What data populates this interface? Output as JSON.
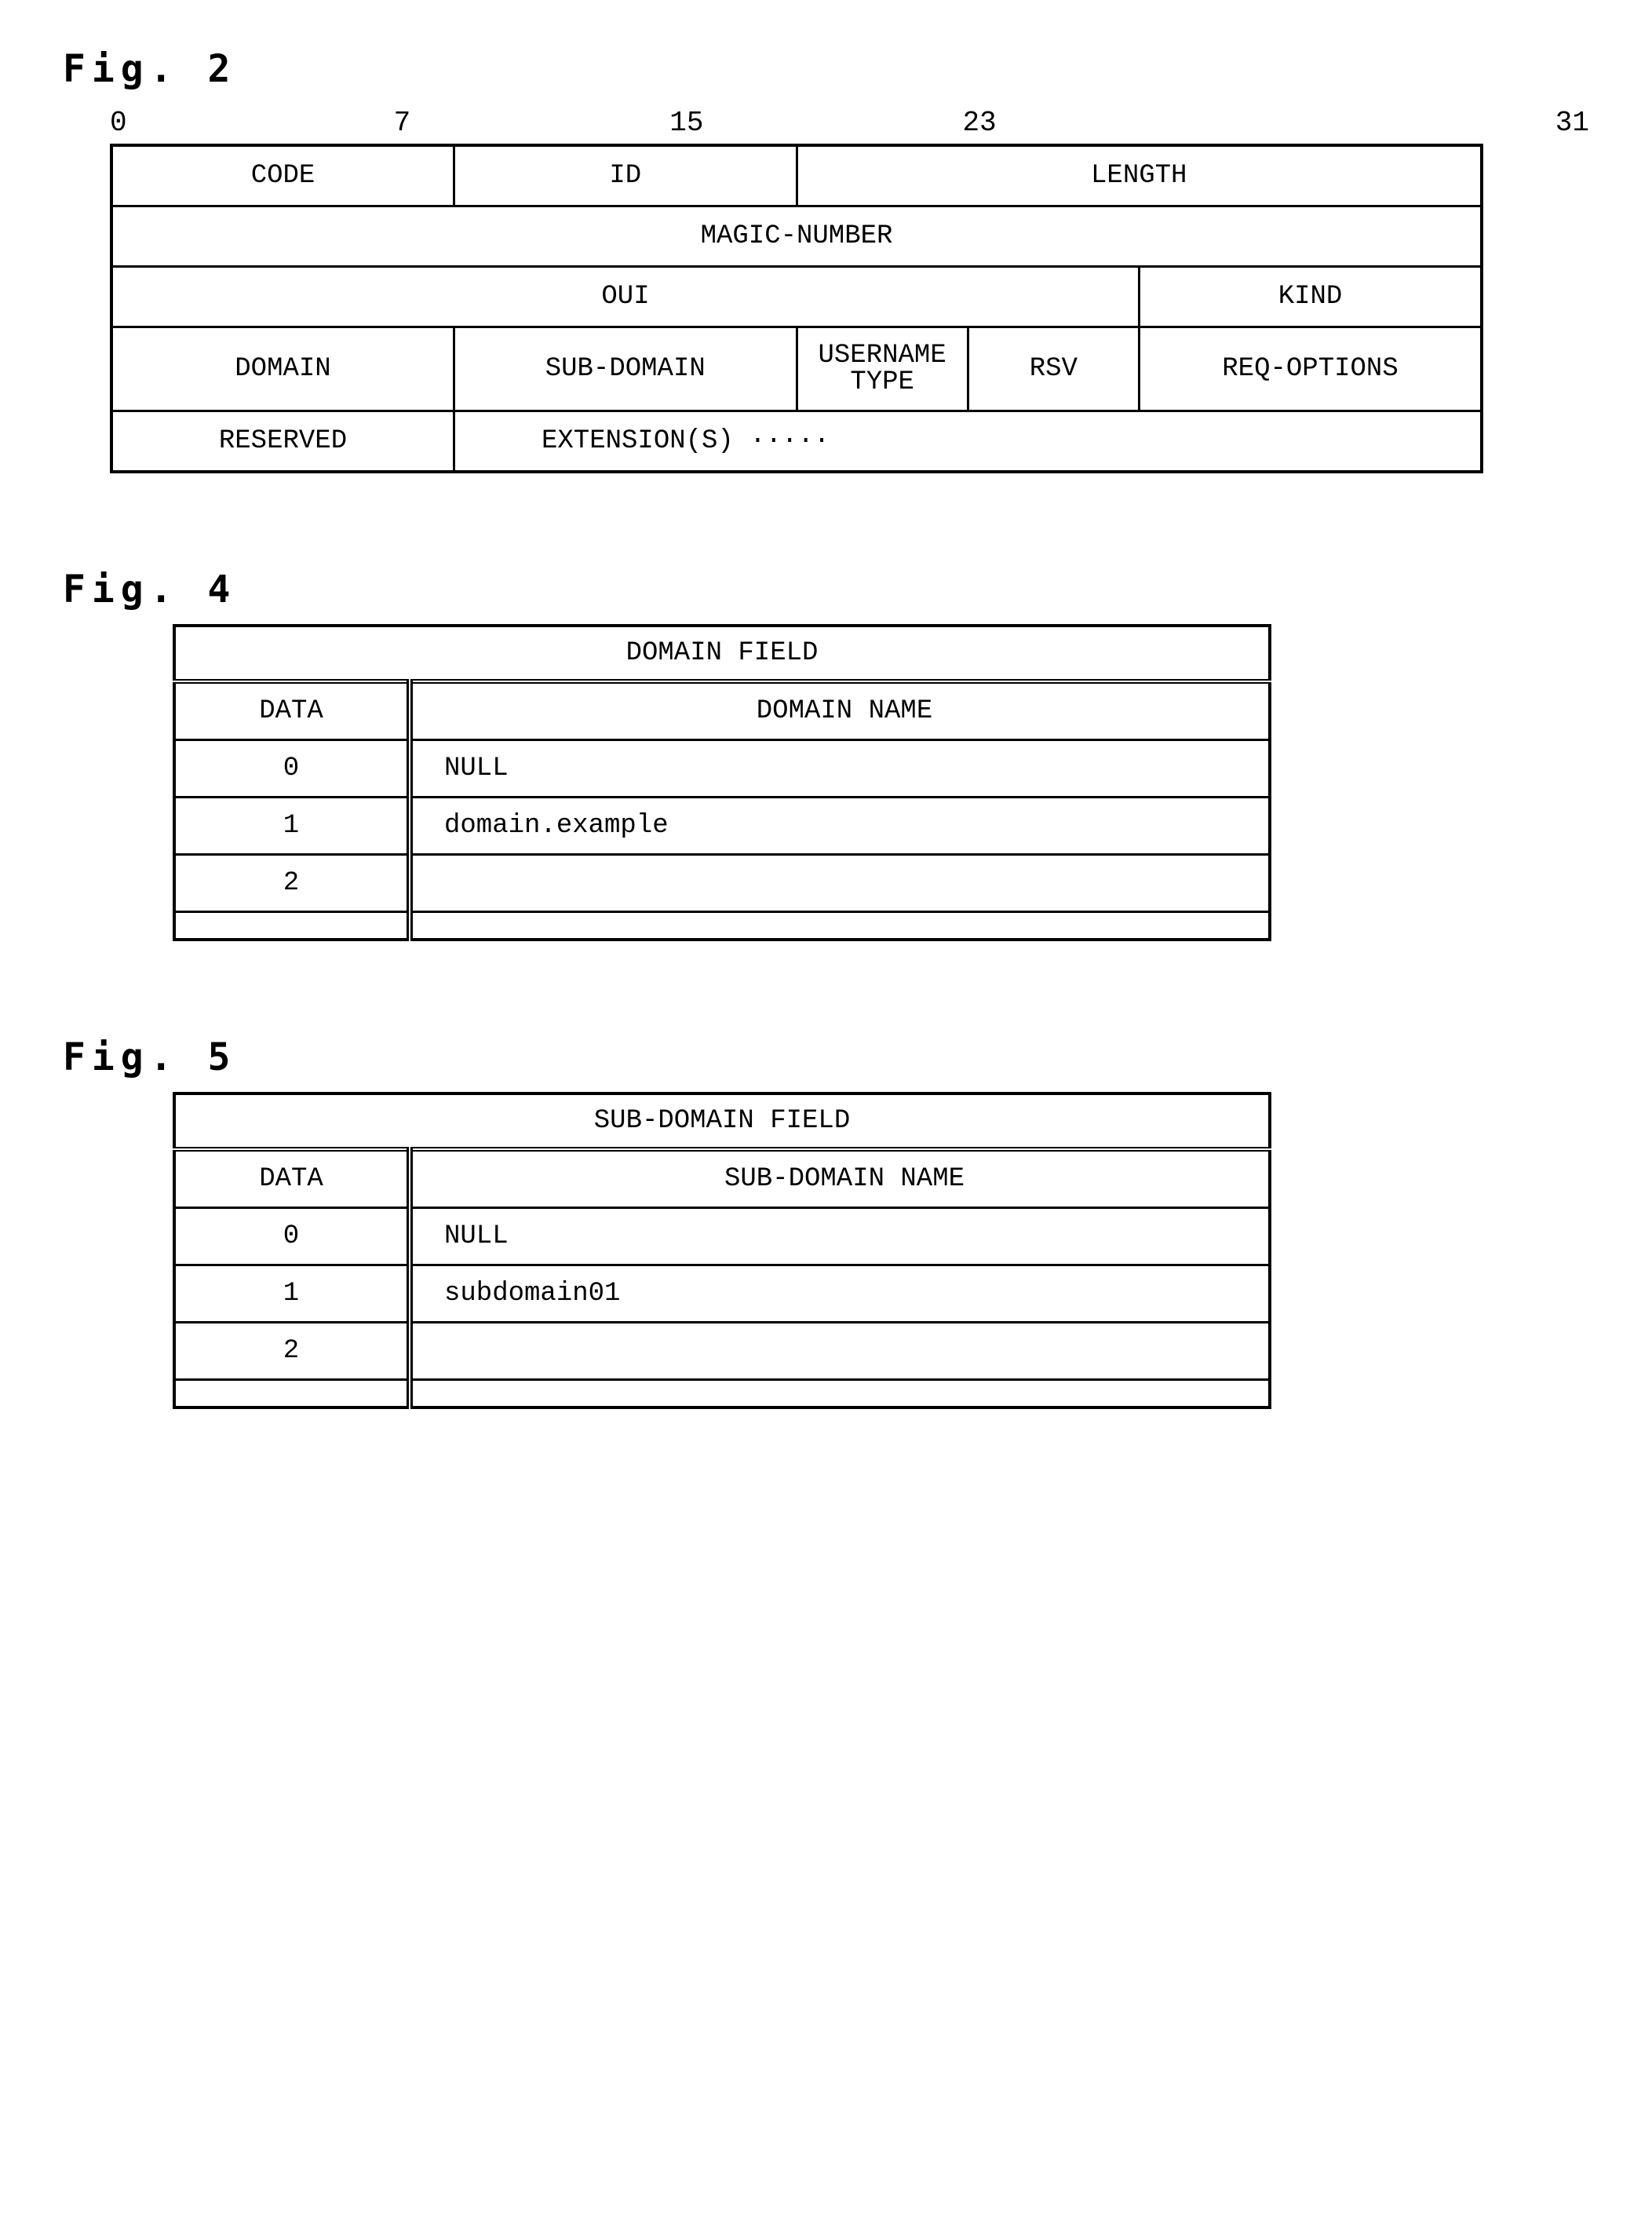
{
  "fig2": {
    "label": "Fig. 2",
    "bits": {
      "b0": "0",
      "b7": "7",
      "b15": "15",
      "b23": "23",
      "b31": "31"
    },
    "cells": {
      "code": "CODE",
      "id": "ID",
      "length": "LENGTH",
      "magic": "MAGIC-NUMBER",
      "oui": "OUI",
      "kind": "KIND",
      "domain": "DOMAIN",
      "subdomain": "SUB-DOMAIN",
      "usernametype": "USERNAME TYPE",
      "rsv": "RSV",
      "reqopt": "REQ-OPTIONS",
      "reserved": "RESERVED",
      "extension": "EXTENSION(S) ·····"
    }
  },
  "fig4": {
    "label": "Fig. 4",
    "title": "DOMAIN FIELD",
    "headers": {
      "data": "DATA",
      "name": "DOMAIN NAME"
    },
    "rows": [
      {
        "data": "0",
        "name": "NULL"
      },
      {
        "data": "1",
        "name": "domain.example"
      },
      {
        "data": "2",
        "name": ""
      }
    ]
  },
  "fig5": {
    "label": "Fig. 5",
    "title": "SUB-DOMAIN FIELD",
    "headers": {
      "data": "DATA",
      "name": "SUB-DOMAIN NAME"
    },
    "rows": [
      {
        "data": "0",
        "name": "NULL"
      },
      {
        "data": "1",
        "name": "subdomain01"
      },
      {
        "data": "2",
        "name": ""
      }
    ]
  }
}
